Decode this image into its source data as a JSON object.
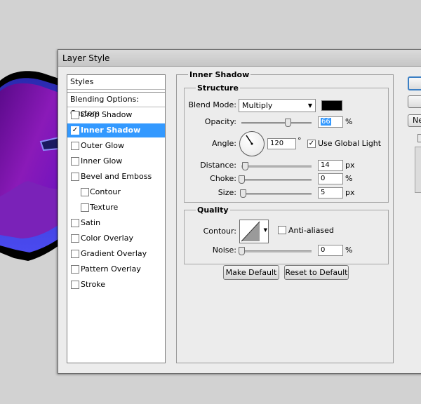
{
  "dialog": {
    "title": "Layer Style"
  },
  "styles_panel": {
    "header": "Styles",
    "blending": "Blending Options: Custom",
    "items": [
      {
        "label": "Drop Shadow",
        "checked": false
      },
      {
        "label": "Inner Shadow",
        "checked": true,
        "selected": true
      },
      {
        "label": "Outer Glow",
        "checked": false
      },
      {
        "label": "Inner Glow",
        "checked": false
      },
      {
        "label": "Bevel and Emboss",
        "checked": false
      },
      {
        "label": "Contour",
        "checked": false,
        "indent": true
      },
      {
        "label": "Texture",
        "checked": false,
        "indent": true
      },
      {
        "label": "Satin",
        "checked": false
      },
      {
        "label": "Color Overlay",
        "checked": false
      },
      {
        "label": "Gradient Overlay",
        "checked": false
      },
      {
        "label": "Pattern Overlay",
        "checked": false
      },
      {
        "label": "Stroke",
        "checked": false
      }
    ]
  },
  "inner_shadow": {
    "title": "Inner Shadow",
    "structure": {
      "title": "Structure",
      "blend_mode_label": "Blend Mode:",
      "blend_mode": "Multiply",
      "color": "#000000",
      "opacity_label": "Opacity:",
      "opacity": "66",
      "opacity_unit": "%",
      "angle_label": "Angle:",
      "angle": "120",
      "angle_unit": "°",
      "global_light_label": "Use Global Light",
      "global_light": true,
      "distance_label": "Distance:",
      "distance": "14",
      "distance_unit": "px",
      "choke_label": "Choke:",
      "choke": "0",
      "choke_unit": "%",
      "size_label": "Size:",
      "size": "5",
      "size_unit": "px"
    },
    "quality": {
      "title": "Quality",
      "contour_label": "Contour:",
      "anti_aliased_label": "Anti-aliased",
      "anti_aliased": false,
      "noise_label": "Noise:",
      "noise": "0",
      "noise_unit": "%"
    },
    "buttons": {
      "make_default": "Make Default",
      "reset_default": "Reset to Default"
    }
  },
  "right_buttons": {
    "new_style": "Ne"
  },
  "sliders": {
    "opacity": 0.66,
    "distance": 0.05,
    "choke": 0.0,
    "size": 0.02,
    "noise": 0.0
  },
  "colors": {
    "selection": "#3399ff",
    "swatch": "#000000",
    "shape_purple": "#7a0fa0",
    "shape_blue": "#3a3ae0"
  }
}
